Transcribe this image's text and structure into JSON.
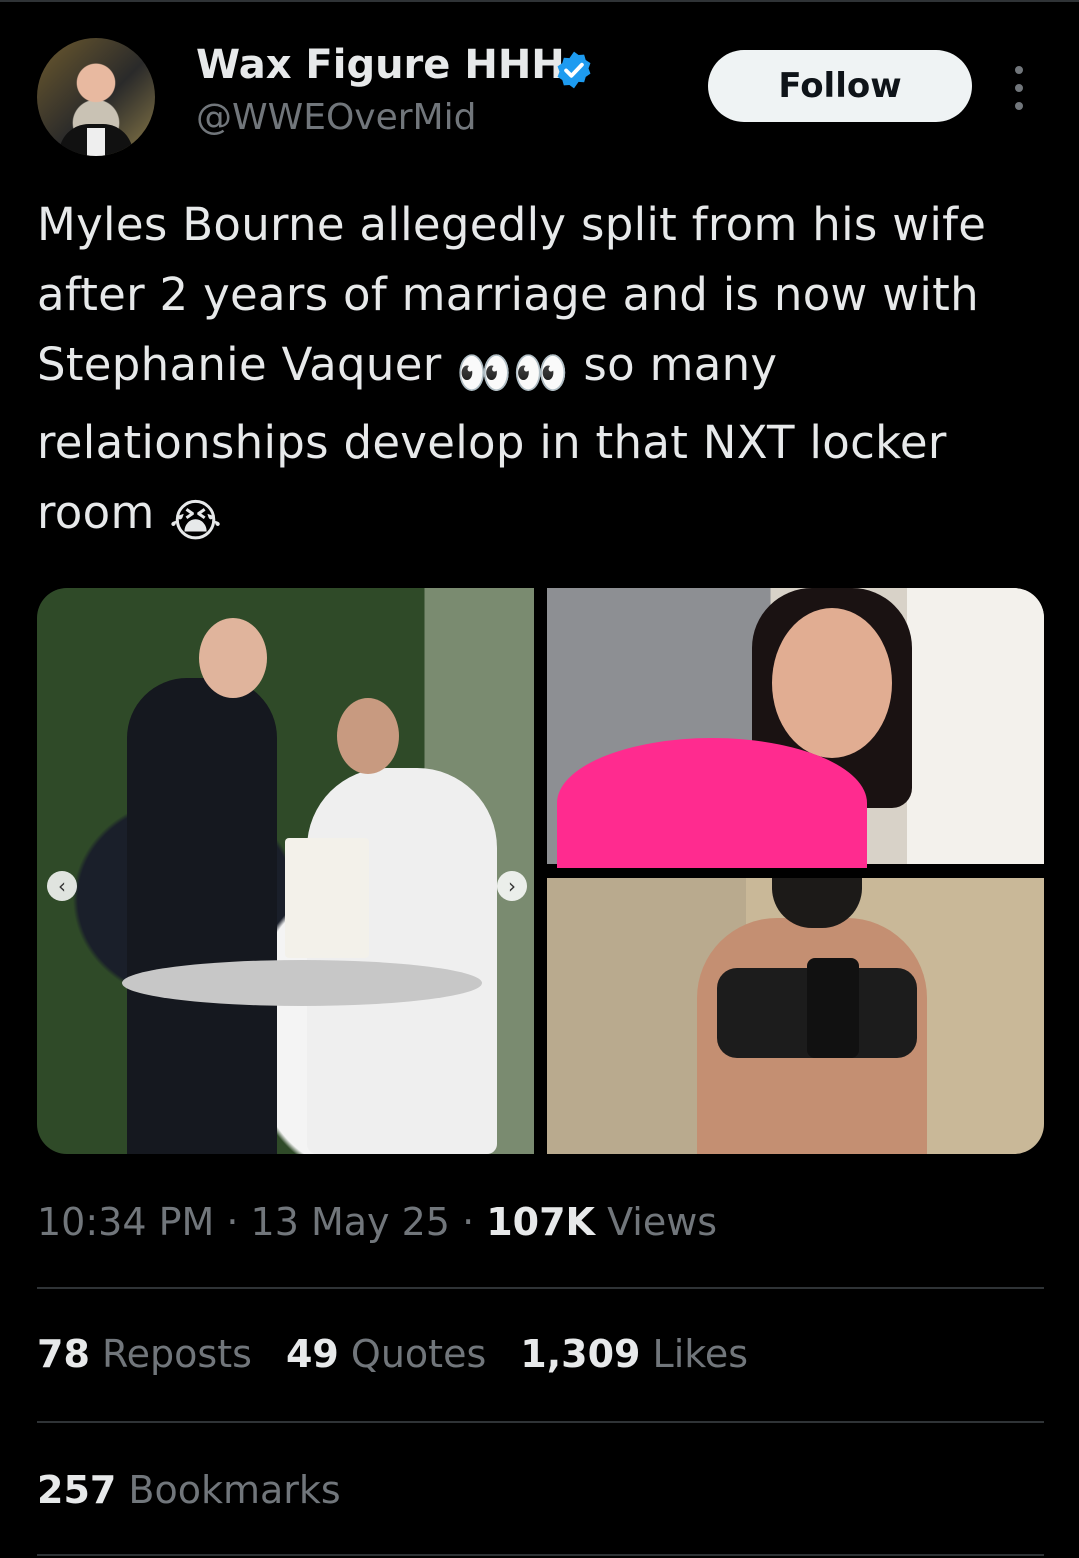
{
  "author": {
    "name": "Wax Figure HHH",
    "handle": "@WWEOverMid",
    "verified_color": "#1d9bf0"
  },
  "actions": {
    "follow_label": "Follow"
  },
  "tweet": {
    "text_part1": "Myles Bourne allegedly split from his wife after 2 years of marriage and is now with Stephanie Vaquer ",
    "text_part2": " so many relationships develop in that NXT locker room ",
    "emoji_eyes": "👀👀",
    "emoji_cry": "😭"
  },
  "media": {
    "count": 3,
    "icons": [
      "chevron-left-icon",
      "chevron-right-icon"
    ]
  },
  "meta": {
    "time": "10:34 PM",
    "date": "13 May 25",
    "views_count": "107K",
    "views_label": "Views"
  },
  "stats": {
    "reposts_count": "78",
    "reposts_label": "Reposts",
    "quotes_count": "49",
    "quotes_label": "Quotes",
    "likes_count": "1,309",
    "likes_label": "Likes",
    "bookmarks_count": "257",
    "bookmarks_label": "Bookmarks"
  }
}
